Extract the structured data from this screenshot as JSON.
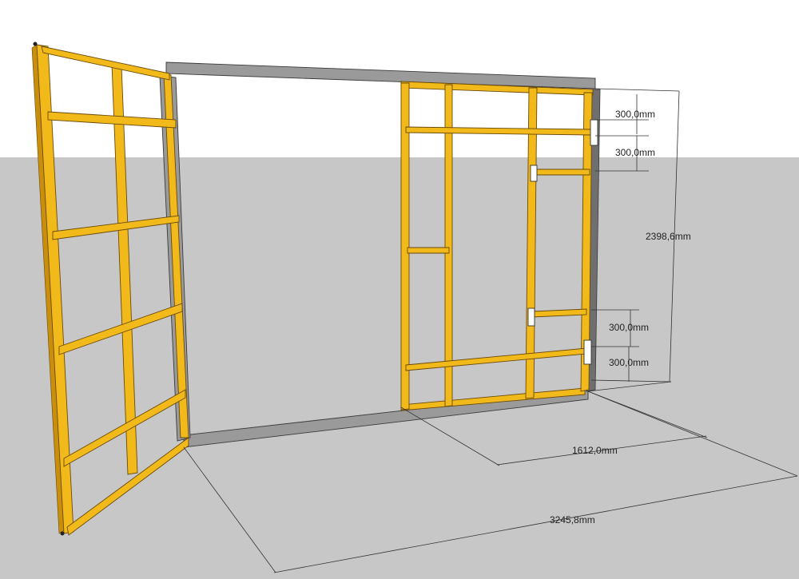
{
  "scene": {
    "sky_color": "#ffffff",
    "ground_color": "#c7c7c7",
    "wood_color": "#f2b91a",
    "metal_color": "#9a9a9a"
  },
  "dimensions": {
    "top_spacing_1": "300,0mm",
    "top_spacing_2": "300,0mm",
    "height": "2398,6mm",
    "bottom_spacing_1": "300,0mm",
    "bottom_spacing_2": "300,0mm",
    "door_width": "1612,0mm",
    "total_width": "3245,8mm"
  }
}
